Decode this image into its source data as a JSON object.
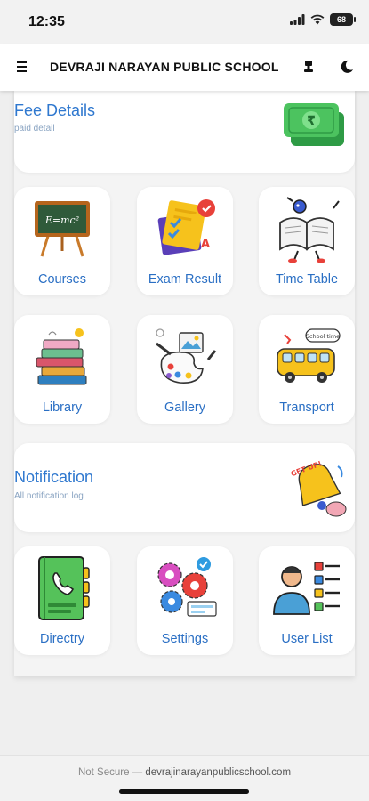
{
  "status_bar": {
    "time": "12:35",
    "battery": "68"
  },
  "app_bar": {
    "title": "DEVRAJI NARAYAN PUBLIC SCHOOL"
  },
  "fee_card": {
    "title": "Fee Details",
    "subtitle": "paid detail",
    "currency_symbol": "₹"
  },
  "row1": [
    {
      "label": "Courses",
      "icon": "chalkboard-easel-icon",
      "board_text": "E=mc²"
    },
    {
      "label": "Exam Result",
      "icon": "exam-papers-icon"
    },
    {
      "label": "Time Table",
      "icon": "open-book-character-icon"
    }
  ],
  "row2": [
    {
      "label": "Library",
      "icon": "book-stack-icon"
    },
    {
      "label": "Gallery",
      "icon": "art-palette-icon"
    },
    {
      "label": "Transport",
      "icon": "school-bus-icon",
      "bubble_text": "School time"
    }
  ],
  "notification_card": {
    "title": "Notification",
    "subtitle": "All notification log",
    "sticker_text": "GET UP!"
  },
  "row3": [
    {
      "label": "Directry",
      "icon": "phone-directory-icon"
    },
    {
      "label": "Settings",
      "icon": "gears-icon"
    },
    {
      "label": "User List",
      "icon": "user-list-icon"
    }
  ],
  "browser": {
    "security": "Not Secure —",
    "domain": "devrajinarayanpublicschool.com"
  },
  "colors": {
    "accent": "#2f78cf",
    "label": "#2a6fc4",
    "background": "#efefef"
  }
}
